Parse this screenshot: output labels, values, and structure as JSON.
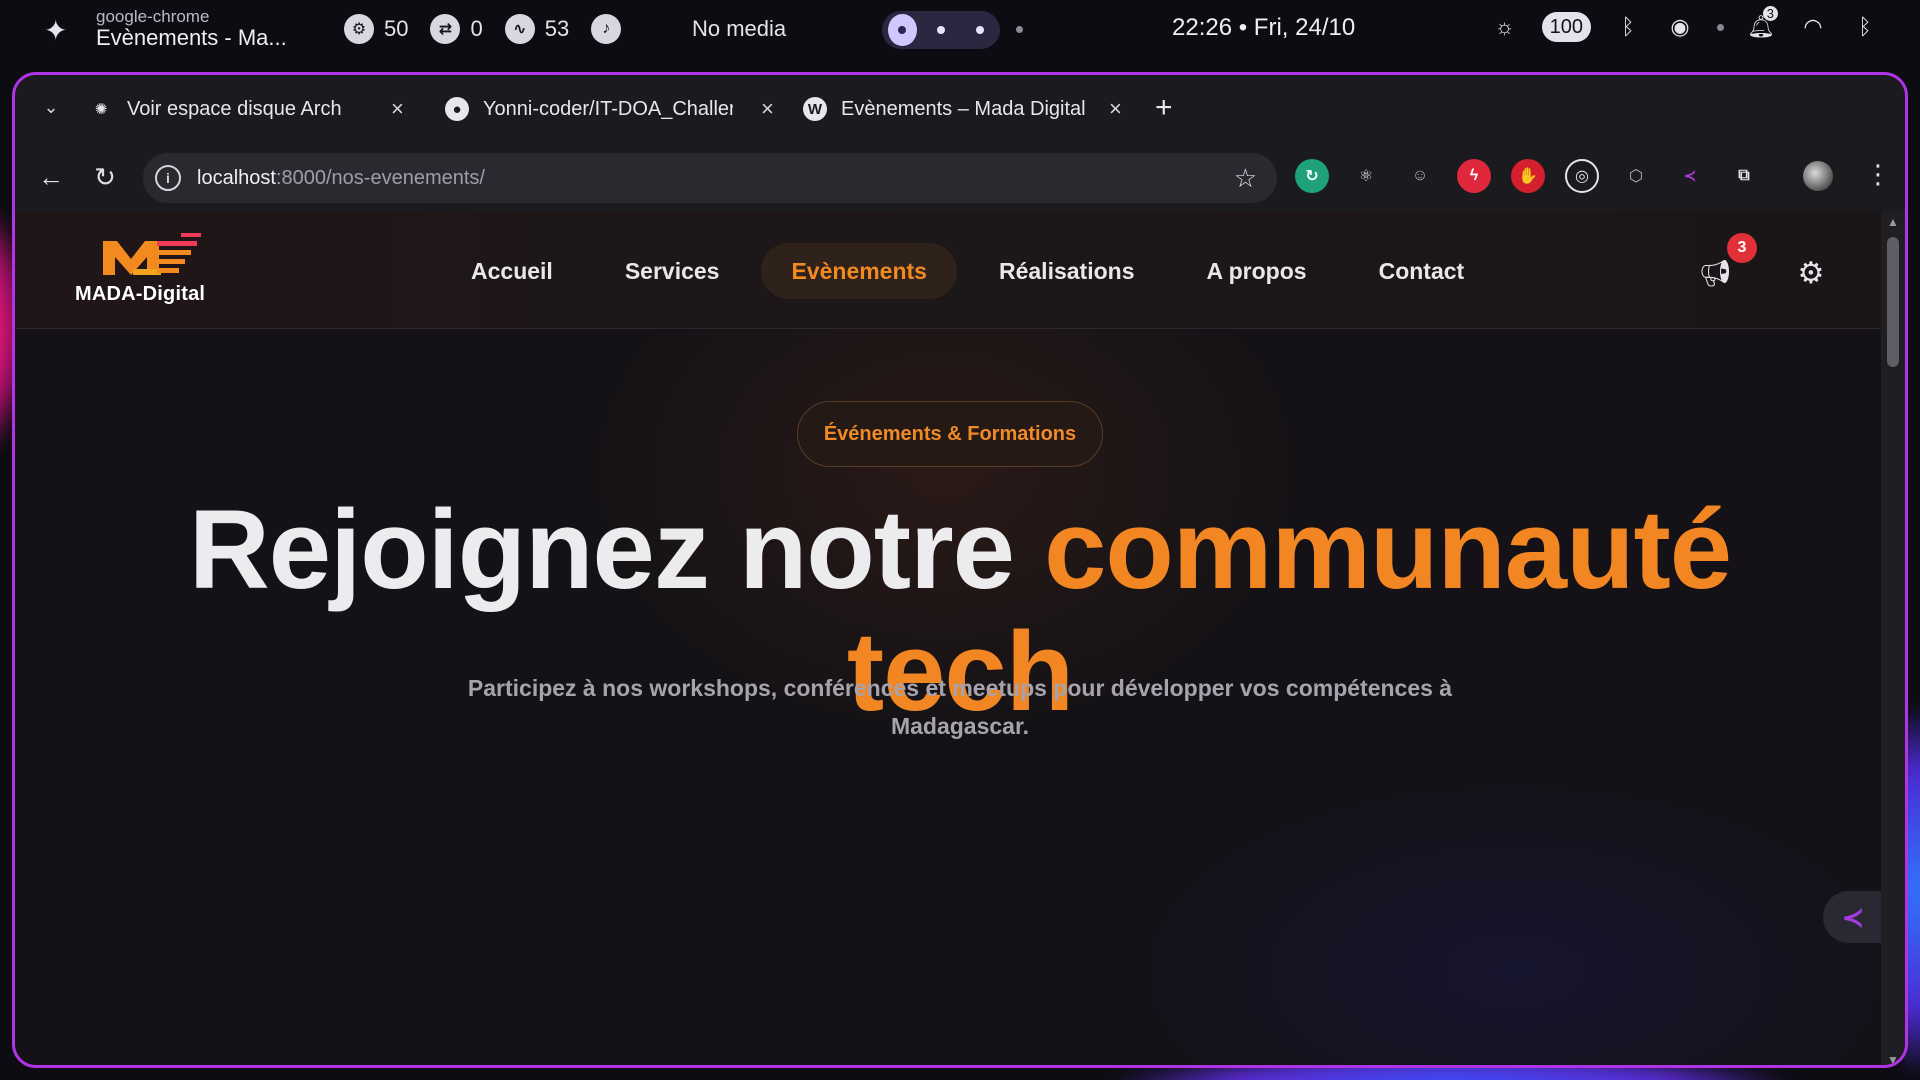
{
  "system": {
    "app_class": "google-chrome",
    "app_title": "Evènements - Ma...",
    "stats": [
      {
        "icon": "cpu-icon",
        "value": "50"
      },
      {
        "icon": "swap-icon",
        "value": "0"
      },
      {
        "icon": "memory-icon",
        "value": "53"
      }
    ],
    "media": "No media",
    "clock": "22:26 • Fri, 24/10",
    "battery": "100",
    "notifications": "3"
  },
  "tabs": [
    {
      "label": "Voir espace disque Arch",
      "icon": "chatgpt-icon"
    },
    {
      "label": "Yonni-coder/IT-DOA_Challer",
      "icon": "github-icon"
    },
    {
      "label": "Evènements – Mada Digital",
      "icon": "wordpress-icon"
    }
  ],
  "omnibox": {
    "host": "localhost",
    "path": ":8000/nos-evenements/"
  },
  "site": {
    "logo_text": "MADA-Digital",
    "nav": [
      {
        "label": "Accueil",
        "active": false
      },
      {
        "label": "Services",
        "active": false
      },
      {
        "label": "Evènements",
        "active": true
      },
      {
        "label": "Réalisations",
        "active": false
      },
      {
        "label": "A propos",
        "active": false
      },
      {
        "label": "Contact",
        "active": false
      }
    ],
    "notification_count": "3",
    "colors": {
      "accent": "#f18622",
      "active_nav_bg": "#2f221b",
      "badge": "#e13038",
      "window_border": "#b133e6"
    }
  },
  "hero": {
    "pill": "Événements & Formations",
    "title_part1": "Rejoignez notre ",
    "title_accent1": "communauté",
    "title_accent2": "tech",
    "subtitle": "Participez à nos workshops, conférences et meetups pour développer vos compétences à Madagascar."
  }
}
